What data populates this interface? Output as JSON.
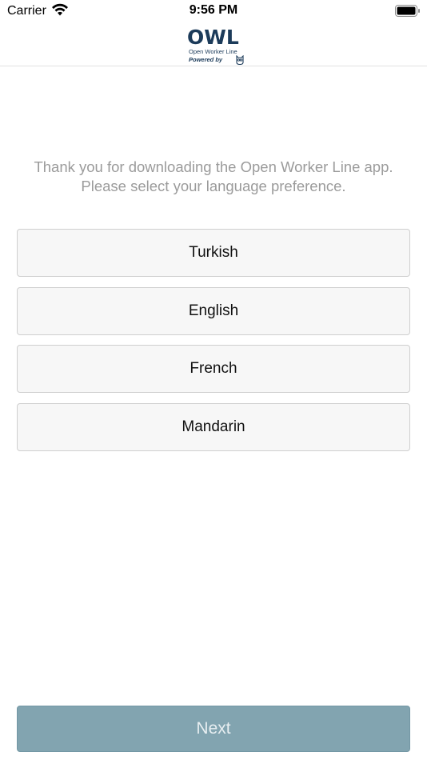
{
  "status_bar": {
    "carrier": "Carrier",
    "time": "9:56 PM",
    "wifi_icon": "wifi-icon",
    "battery_icon": "battery-icon"
  },
  "header": {
    "logo_wordmark": "OWL",
    "logo_subtitle": "Open Worker Line",
    "logo_powered_by": "Powered by",
    "brand_color": "#1c3b5a"
  },
  "intro": {
    "line1": "Thank you for downloading the Open Worker Line app.",
    "line2": "Please select your language preference."
  },
  "languages": [
    {
      "label": "Turkish"
    },
    {
      "label": "English"
    },
    {
      "label": "French"
    },
    {
      "label": "Mandarin"
    }
  ],
  "footer": {
    "next_label": "Next",
    "next_color": "#82a4b0"
  }
}
